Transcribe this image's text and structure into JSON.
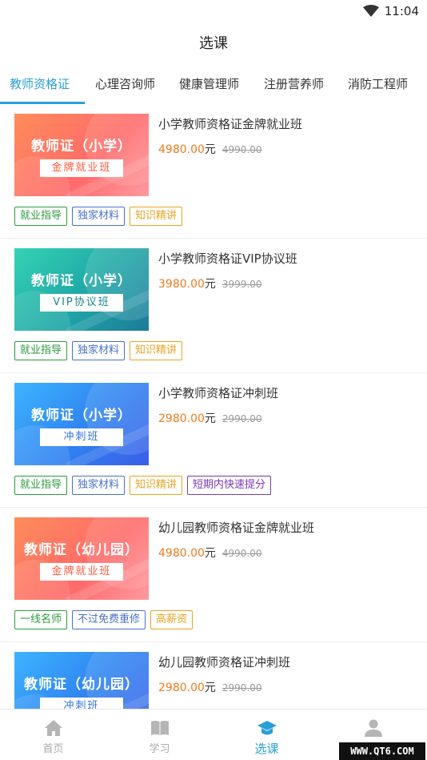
{
  "status_bar": {
    "time": "11:04",
    "wifi_icon": "wifi-icon"
  },
  "header": {
    "title": "选课"
  },
  "tabs": [
    {
      "label": "教师资格证",
      "active": true
    },
    {
      "label": "心理咨询师"
    },
    {
      "label": "健康管理师"
    },
    {
      "label": "注册营养师"
    },
    {
      "label": "消防工程师"
    }
  ],
  "courses": [
    {
      "title": "小学教师资格证金牌就业班",
      "price": "4980.00",
      "unit": "元",
      "old_price": "4990.00",
      "thumb": {
        "line1": "教师证（小学）",
        "line2": "金牌就业班",
        "theme": "orange"
      },
      "tags": [
        "就业指导",
        "独家材料",
        "知识精讲"
      ]
    },
    {
      "title": "小学教师资格证VIP协议班",
      "price": "3980.00",
      "unit": "元",
      "old_price": "3999.00",
      "thumb": {
        "line1": "教师证（小学）",
        "line2": "VIP协议班",
        "theme": "teal"
      },
      "tags": [
        "就业指导",
        "独家材料",
        "知识精讲"
      ]
    },
    {
      "title": "小学教师资格证冲刺班",
      "price": "2980.00",
      "unit": "元",
      "old_price": "2990.00",
      "thumb": {
        "line1": "教师证（小学）",
        "line2": "冲刺班",
        "theme": "blue"
      },
      "tags": [
        "就业指导",
        "独家材料",
        "知识精讲",
        "短期内快速提分"
      ]
    },
    {
      "title": "幼儿园教师资格证金牌就业班",
      "price": "4980.00",
      "unit": "元",
      "old_price": "4990.00",
      "thumb": {
        "line1": "教师证（幼儿园）",
        "line2": "金牌就业班",
        "theme": "orange"
      },
      "tags": [
        "一线名师",
        "不过免费重修",
        "高薪资"
      ]
    },
    {
      "title": "幼儿园教师资格证冲刺班",
      "price": "2980.00",
      "unit": "元",
      "old_price": "2990.00",
      "thumb": {
        "line1": "教师证（幼儿园）",
        "line2": "冲刺班",
        "theme": "blue"
      },
      "tags": []
    }
  ],
  "bottom_nav": [
    {
      "label": "首页",
      "icon": "home-icon"
    },
    {
      "label": "学习",
      "icon": "book-icon"
    },
    {
      "label": "选课",
      "icon": "graduation-cap-icon",
      "active": true
    },
    {
      "label": "",
      "icon": "user-icon"
    }
  ],
  "watermark": "WWW.QT6.COM",
  "colors": {
    "accent": "#2a9fd6",
    "price": "#f07a1c"
  }
}
